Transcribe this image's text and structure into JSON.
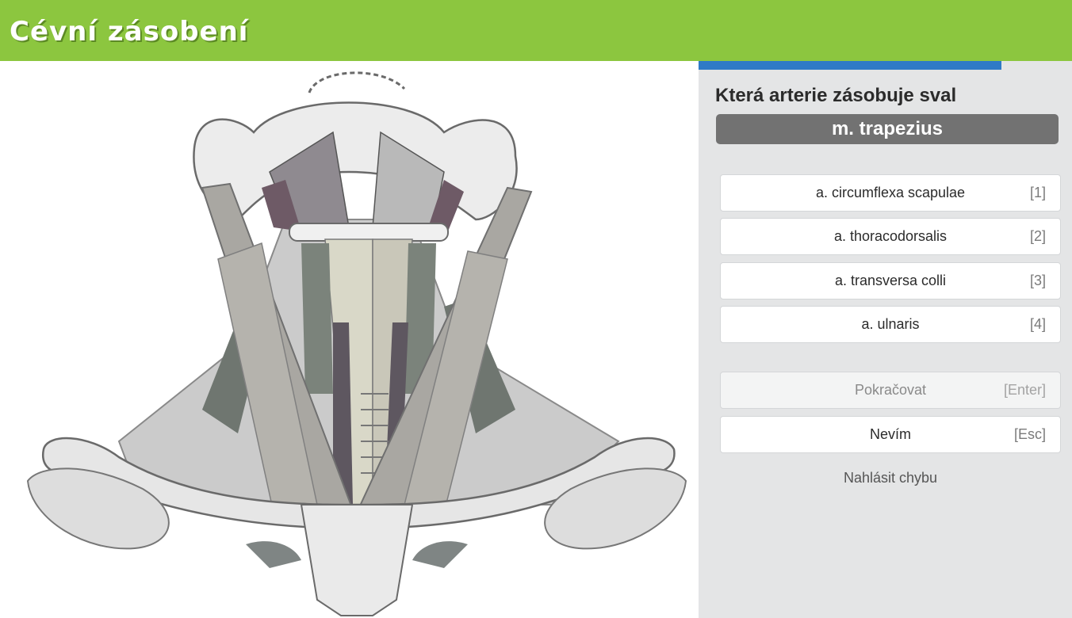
{
  "header": {
    "title": "Cévní zásobení",
    "bg_color": "#8cc63f"
  },
  "progress": {
    "fraction": 0.81,
    "color": "#2f7ac6"
  },
  "quiz": {
    "question": "Která arterie zásobuje sval",
    "subject": "m. trapezius",
    "options": [
      {
        "label": "a. circumflexa scapulae",
        "key": "[1]"
      },
      {
        "label": "a. thoracodorsalis",
        "key": "[2]"
      },
      {
        "label": "a. transversa colli",
        "key": "[3]"
      },
      {
        "label": "a. ulnaris",
        "key": "[4]"
      }
    ],
    "continue": {
      "label": "Pokračovat",
      "key": "[Enter]"
    },
    "dont_know": {
      "label": "Nevím",
      "key": "[Esc]"
    },
    "report": "Nahlásit chybu"
  },
  "illustration": {
    "icon": "neck-muscles-anatomy-illustration"
  }
}
